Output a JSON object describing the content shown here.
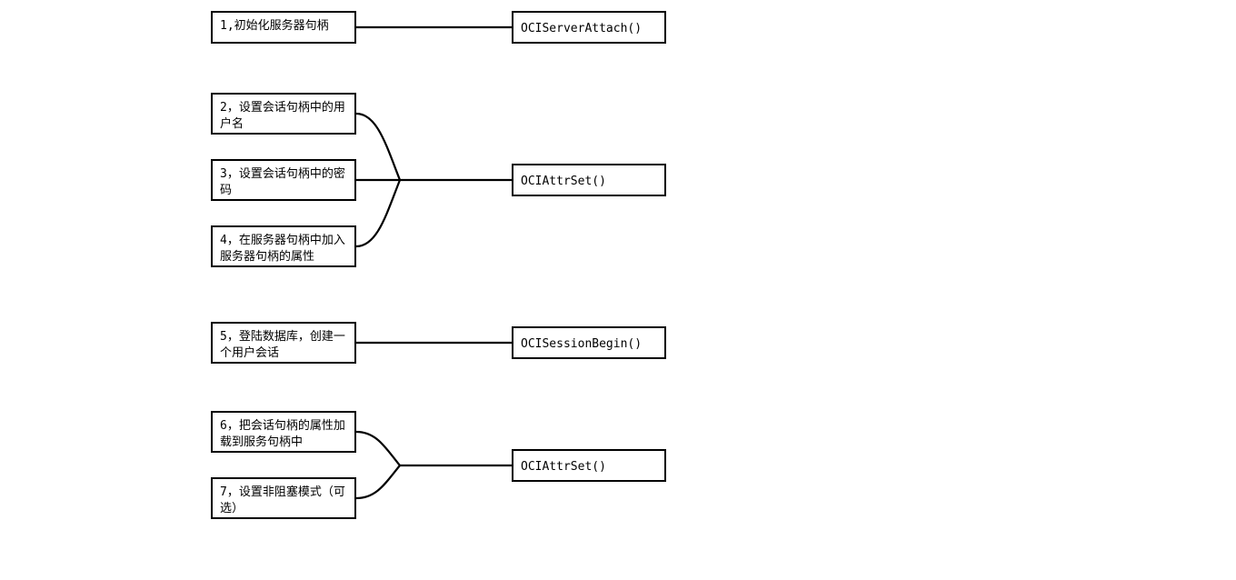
{
  "steps": {
    "s1": "1,初始化服务器句柄",
    "s2": "2，设置会话句柄中的用户名",
    "s3": "3，设置会话句柄中的密码",
    "s4": "4，在服务器句柄中加入服务器句柄的属性",
    "s5": "5，登陆数据库，创建一个用户会话",
    "s6": "6，把会话句柄的属性加载到服务句柄中",
    "s7": "7，设置非阻塞模式（可选）"
  },
  "apis": {
    "a1": "OCIServerAttach()",
    "a2": "OCIAttrSet()",
    "a3": "OCISessionBegin()",
    "a4": "OCIAttrSet()"
  },
  "layout": {
    "leftX": 232,
    "rightX": 563,
    "leftW": 160,
    "rightW": 170
  }
}
